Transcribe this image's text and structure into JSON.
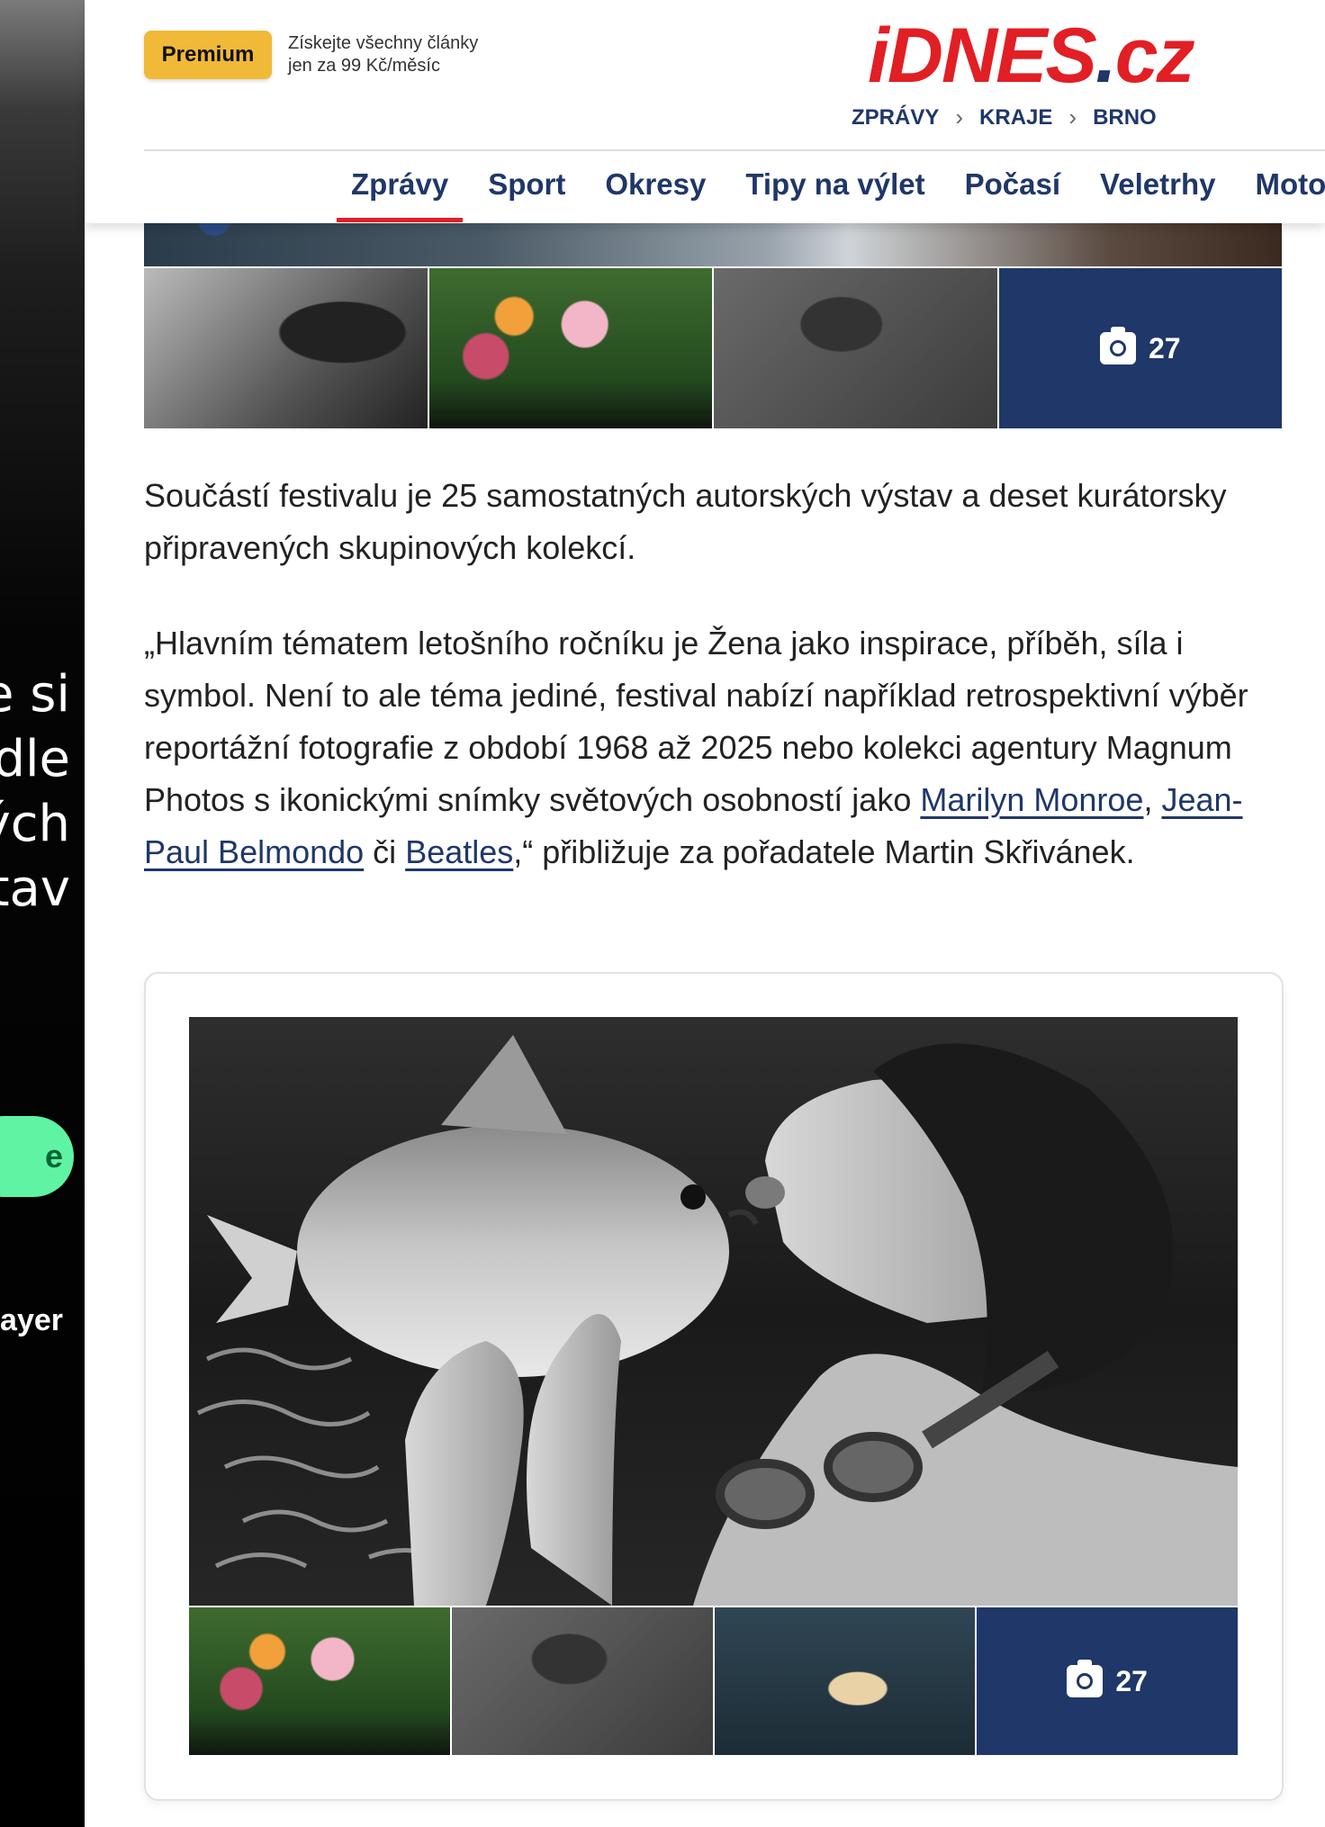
{
  "left_ad": {
    "text_lines": [
      "e si",
      "dle",
      "ých",
      "stav"
    ],
    "pill_label": "e",
    "small_text": "ayer"
  },
  "header": {
    "premium_label": "Premium",
    "promo_line1": "Získejte všechny články",
    "promo_line2": "jen za 99 Kč/měsíc",
    "logo": {
      "part1": "iDNES",
      "dot": ".",
      "part2": "cz"
    },
    "breadcrumbs": [
      "ZPRÁVY",
      "KRAJE",
      "BRNO"
    ],
    "nav": [
      "Zprávy",
      "Sport",
      "Okresy",
      "Tipy na výlet",
      "Počasí",
      "Veletrhy",
      "Moto GP"
    ],
    "active_nav": "Zprávy"
  },
  "gallery1": {
    "photo_count": "27"
  },
  "article": {
    "p1": "Součástí festivalu je 25 samostatných autorských výstav a deset kurátorsky připravených skupinových kolekcí.",
    "p2_start": "„Hlavním tématem letošního ročníku je Žena jako inspirace, příběh, síla i symbol. Není to ale téma jediné, festival nabízí například retrospektivní výběr reportážní fotografie z období 1968 až 2025 nebo kolekci agentury Magnum Photos s ikonickými snímky světových osobností jako ",
    "link1": "Marilyn Monroe",
    "sep1": ", ",
    "link2": "Jean-Paul Belmondo",
    "sep2": " či ",
    "link3": "Beatles",
    "p2_end": ",“ přibližuje za pořadatele Martin Skřivánek."
  },
  "gallery2": {
    "photo_count": "27"
  },
  "colors": {
    "brand_red": "#e11f24",
    "brand_navy": "#1f3769",
    "premium_yellow": "#f0b938"
  }
}
